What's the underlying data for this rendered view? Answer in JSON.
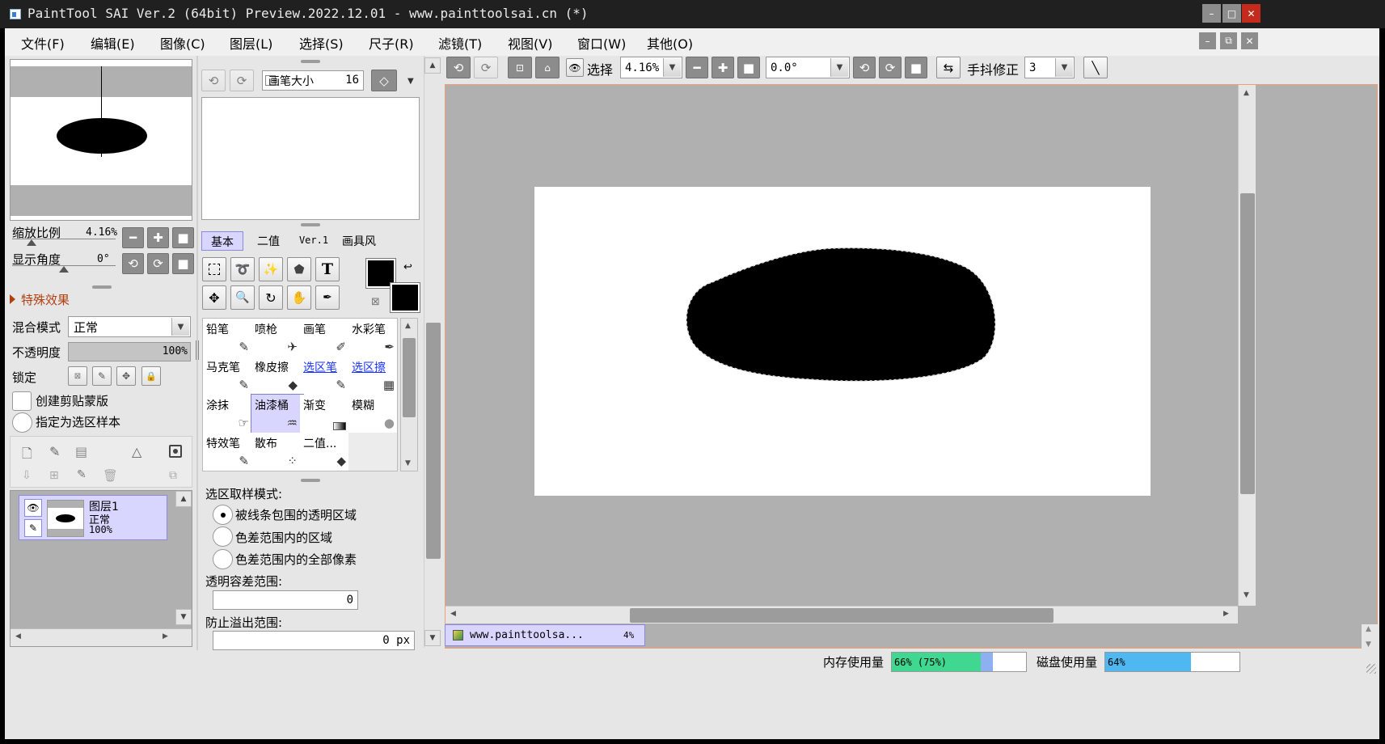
{
  "window": {
    "title": "PaintTool SAI Ver.2 (64bit) Preview.2022.12.01 - www.painttoolsai.cn (*)"
  },
  "menu": [
    "文件(F)",
    "编辑(E)",
    "图像(C)",
    "图层(L)",
    "选择(S)",
    "尺子(R)",
    "滤镜(T)",
    "视图(V)",
    "窗口(W)",
    "其他(O)"
  ],
  "navigator": {
    "zoom_label": "缩放比例",
    "zoom_value": "4.16%",
    "angle_label": "显示角度",
    "angle_value": "0°"
  },
  "layer_panel": {
    "effects_label": "特殊效果",
    "blend_label": "混合模式",
    "blend_value": "正常",
    "opacity_label": "不透明度",
    "opacity_value": "100%",
    "opacity_fraction": 1.0,
    "lock_label": "锁定",
    "clip_label": "创建剪贴蒙版",
    "sample_label": "指定为选区样本",
    "layer": {
      "name": "图层1",
      "mode": "正常",
      "opacity": "100%"
    }
  },
  "brush": {
    "size_label": "画笔大小",
    "size_value": "16"
  },
  "tool_tabs": [
    "基本",
    "二值",
    "Ver.1",
    "画具风"
  ],
  "tools": [
    {
      "label": "铅笔",
      "icon": "✎"
    },
    {
      "label": "喷枪",
      "icon": "✈"
    },
    {
      "label": "画笔",
      "icon": "✐"
    },
    {
      "label": "水彩笔",
      "icon": "✒"
    },
    {
      "label": "马克笔",
      "icon": "✎"
    },
    {
      "label": "橡皮擦",
      "icon": "◆"
    },
    {
      "label": "选区笔",
      "icon": "✎"
    },
    {
      "label": "选区擦",
      "icon": "▦"
    },
    {
      "label": "涂抹",
      "icon": "☞"
    },
    {
      "label": "油漆桶",
      "icon": "♒"
    },
    {
      "label": "渐变",
      "icon": "▬"
    },
    {
      "label": "模糊",
      "icon": "💧"
    },
    {
      "label": "特效笔",
      "icon": "✎"
    },
    {
      "label": "散布",
      "icon": "⁘"
    },
    {
      "label": "二值...",
      "icon": "◆"
    }
  ],
  "tool_options": {
    "mode_label": "选区取样模式:",
    "options": [
      "被线条包围的透明区域",
      "色差范围内的区域",
      "色差范围内的全部像素"
    ],
    "tolerance_label": "透明容差范围:",
    "tolerance_value": "0",
    "overflow_label": "防止溢出范围:",
    "overflow_value": "0 px"
  },
  "toolbar": {
    "select_label": "选择",
    "zoom_value": "4.16%",
    "angle_value": "0.0°",
    "stabilizer_label": "手抖修正",
    "stabilizer_value": "3"
  },
  "canvas_tab": {
    "name": "www.painttoolsa...",
    "zoom": "4%"
  },
  "status": {
    "memory_label": "内存使用量",
    "memory_value": "66% (75%)",
    "memory_fraction": 0.66,
    "memory_peak_fraction": 0.75,
    "disk_label": "磁盘使用量",
    "disk_value": "64%",
    "disk_fraction": 0.64
  },
  "colors": {
    "titlebar_bg": "#202020",
    "canvas_bg": "#b0b0b0",
    "selected_bg": "#d8d6ff",
    "accent_orange": "#f0a070",
    "memory_green": "#40d890",
    "memory_peak": "#8cb0f0",
    "disk_blue": "#50b8f0"
  }
}
